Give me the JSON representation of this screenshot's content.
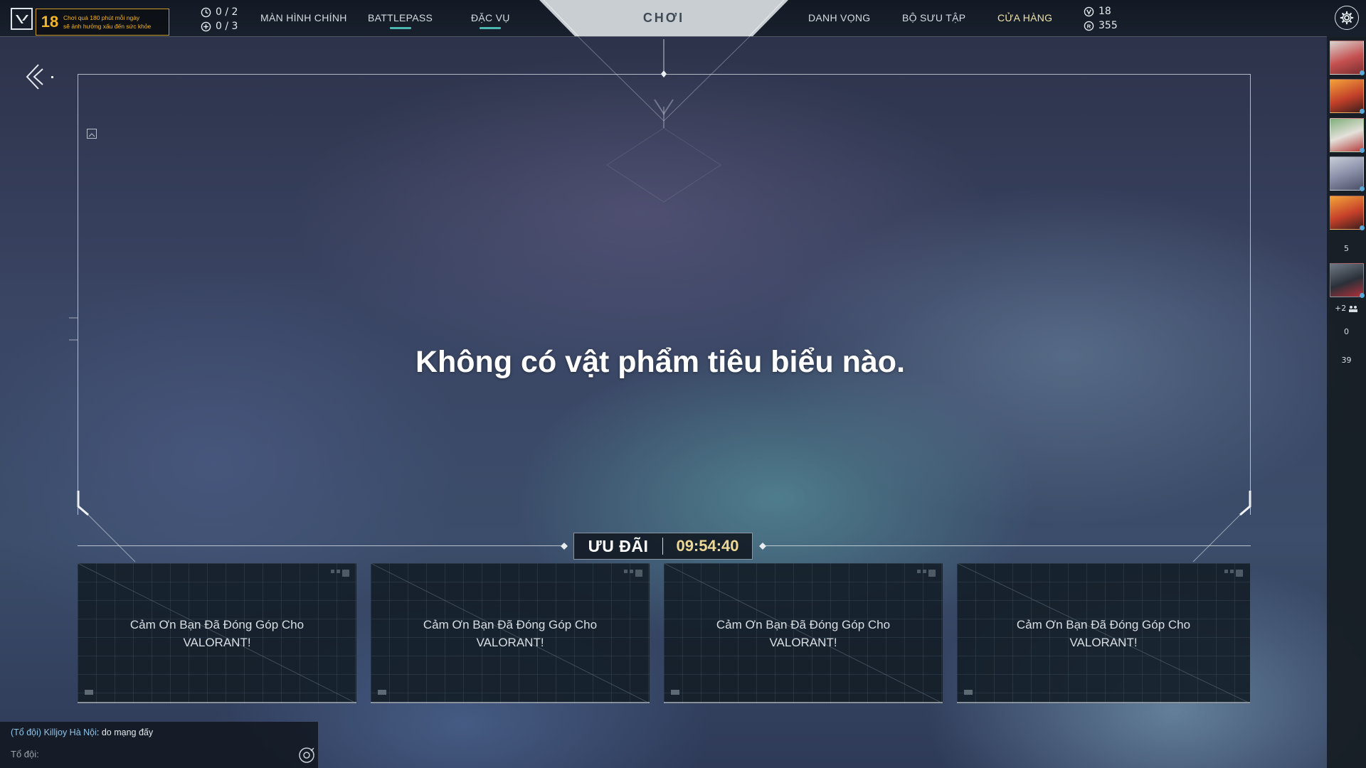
{
  "topbar": {
    "age_rating": "18",
    "age_warning_line1": "Chơi quá 180 phút mỗi ngày",
    "age_warning_line2": "sẽ ảnh hưởng xấu đến sức khỏe",
    "counter_time": "0 / 2",
    "counter_plus": "0 / 3",
    "nav": {
      "home": "MÀN HÌNH CHÍNH",
      "battlepass": "BATTLEPASS",
      "agents": "ĐẶC VỤ",
      "play": "CHƠI",
      "career": "DANH VỌNG",
      "collection": "BỘ SƯU TẬP",
      "store": "CỬA HÀNG"
    },
    "valorant_points": "18",
    "radianite_points": "355"
  },
  "featured": {
    "empty_message": "Không có vật phẩm tiêu biểu nào."
  },
  "offers": {
    "title": "ƯU ĐÃI",
    "timer": "09:54:40",
    "cards": [
      {
        "text": "Cảm Ơn Bạn Đã Đóng Góp Cho VALORANT!"
      },
      {
        "text": "Cảm Ơn Bạn Đã Đóng Góp Cho VALORANT!"
      },
      {
        "text": "Cảm Ơn Bạn Đã Đóng Góp Cho VALORANT!"
      },
      {
        "text": "Cảm Ơn Bạn Đã Đóng Góp Cho VALORANT!"
      }
    ]
  },
  "social": {
    "online_count": "5",
    "party_extra": "+2",
    "count_a": "0",
    "count_b": "39"
  },
  "chat": {
    "channel": "(Tổ đội)",
    "sender": "Killjoy Hà Nội",
    "message": "do mạng đấy",
    "input_label": "Tổ đội:"
  },
  "colors": {
    "accent_teal": "#4bb7b0",
    "timer_gold": "#eed895",
    "store_active": "#ede3a8",
    "age_badge": "#f2b527"
  }
}
